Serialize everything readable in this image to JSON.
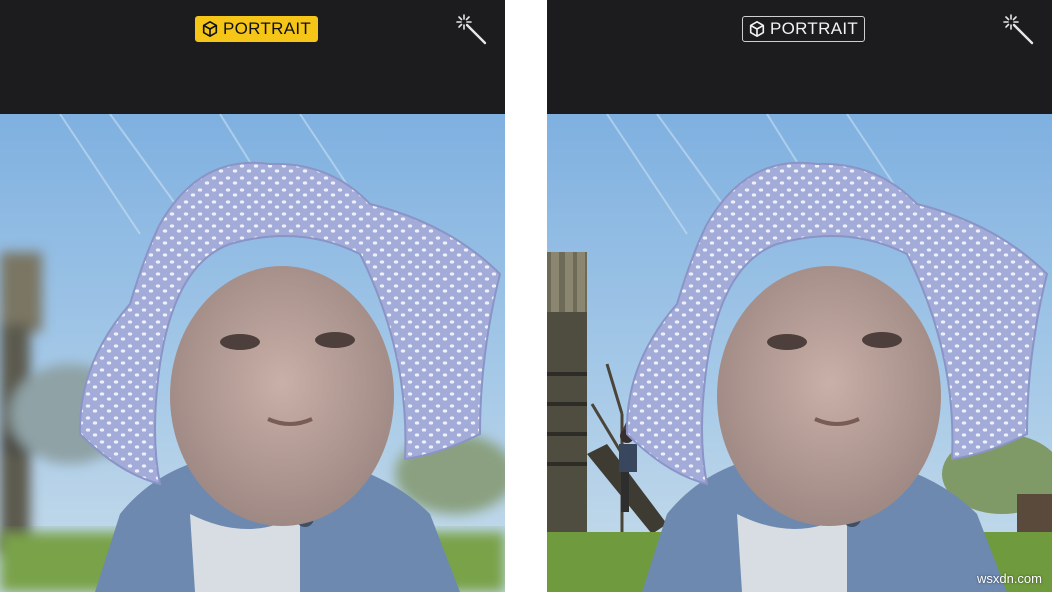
{
  "panels": [
    {
      "badge": {
        "label": "PORTRAIT",
        "state": "active",
        "color": "#f5c518"
      },
      "icons": {
        "badge_icon": "cube-icon",
        "tool_icon": "magic-wand-icon"
      },
      "background_depth": "blurred"
    },
    {
      "badge": {
        "label": "PORTRAIT",
        "state": "inactive"
      },
      "icons": {
        "badge_icon": "cube-icon",
        "tool_icon": "magic-wand-icon"
      },
      "background_depth": "sharp"
    }
  ],
  "watermark": "wsxdn.com",
  "colors": {
    "topbar": "#1c1c1e",
    "accent": "#f5c518",
    "sky": "#9fc4e6",
    "grass": "#6f9a3e",
    "hat": "#9ea8d8",
    "jacket": "#6d89b0"
  }
}
